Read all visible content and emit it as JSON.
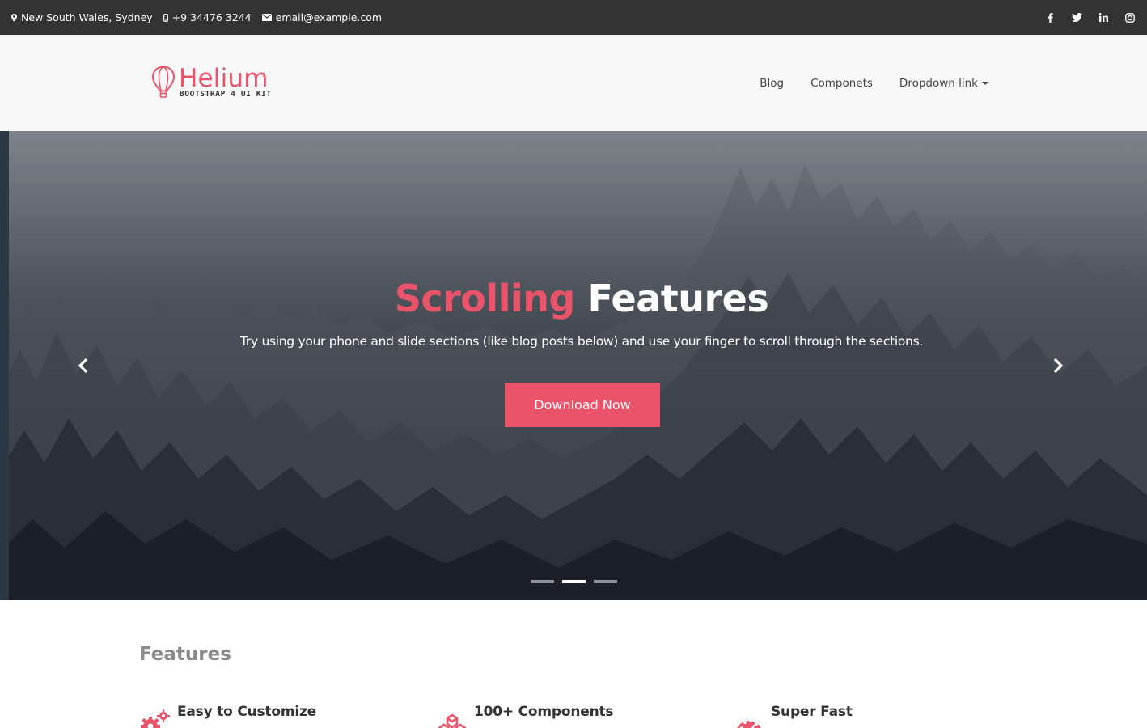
{
  "topbar": {
    "location": "New South Wales, Sydney",
    "phone": "+9 34476 3244",
    "email": "email@example.com",
    "social": [
      "facebook-icon",
      "twitter-icon",
      "linkedin-icon",
      "instagram-icon"
    ]
  },
  "brand": {
    "name": "Helium",
    "tagline": "BOOTSTRAP 4 UI KIT",
    "accent_color": "#e9546b"
  },
  "nav": {
    "items": [
      {
        "label": "Blog"
      },
      {
        "label": "Componets"
      },
      {
        "label": "Dropdown link",
        "dropdown": true
      }
    ]
  },
  "hero": {
    "title_accent": "Scrolling",
    "title_main": "Features",
    "subtitle": "Try using your phone and slide sections (like blog posts below) and use your finger to scroll through the sections.",
    "cta_label": "Download Now",
    "slide_count": 3,
    "active_slide": 2
  },
  "features": {
    "section_title": "Features",
    "items": [
      {
        "title": "Easy to Customize",
        "icon": "gears-icon"
      },
      {
        "title": "100+ Components",
        "icon": "cubes-icon"
      },
      {
        "title": "Super Fast",
        "icon": "speedometer-icon"
      }
    ]
  }
}
